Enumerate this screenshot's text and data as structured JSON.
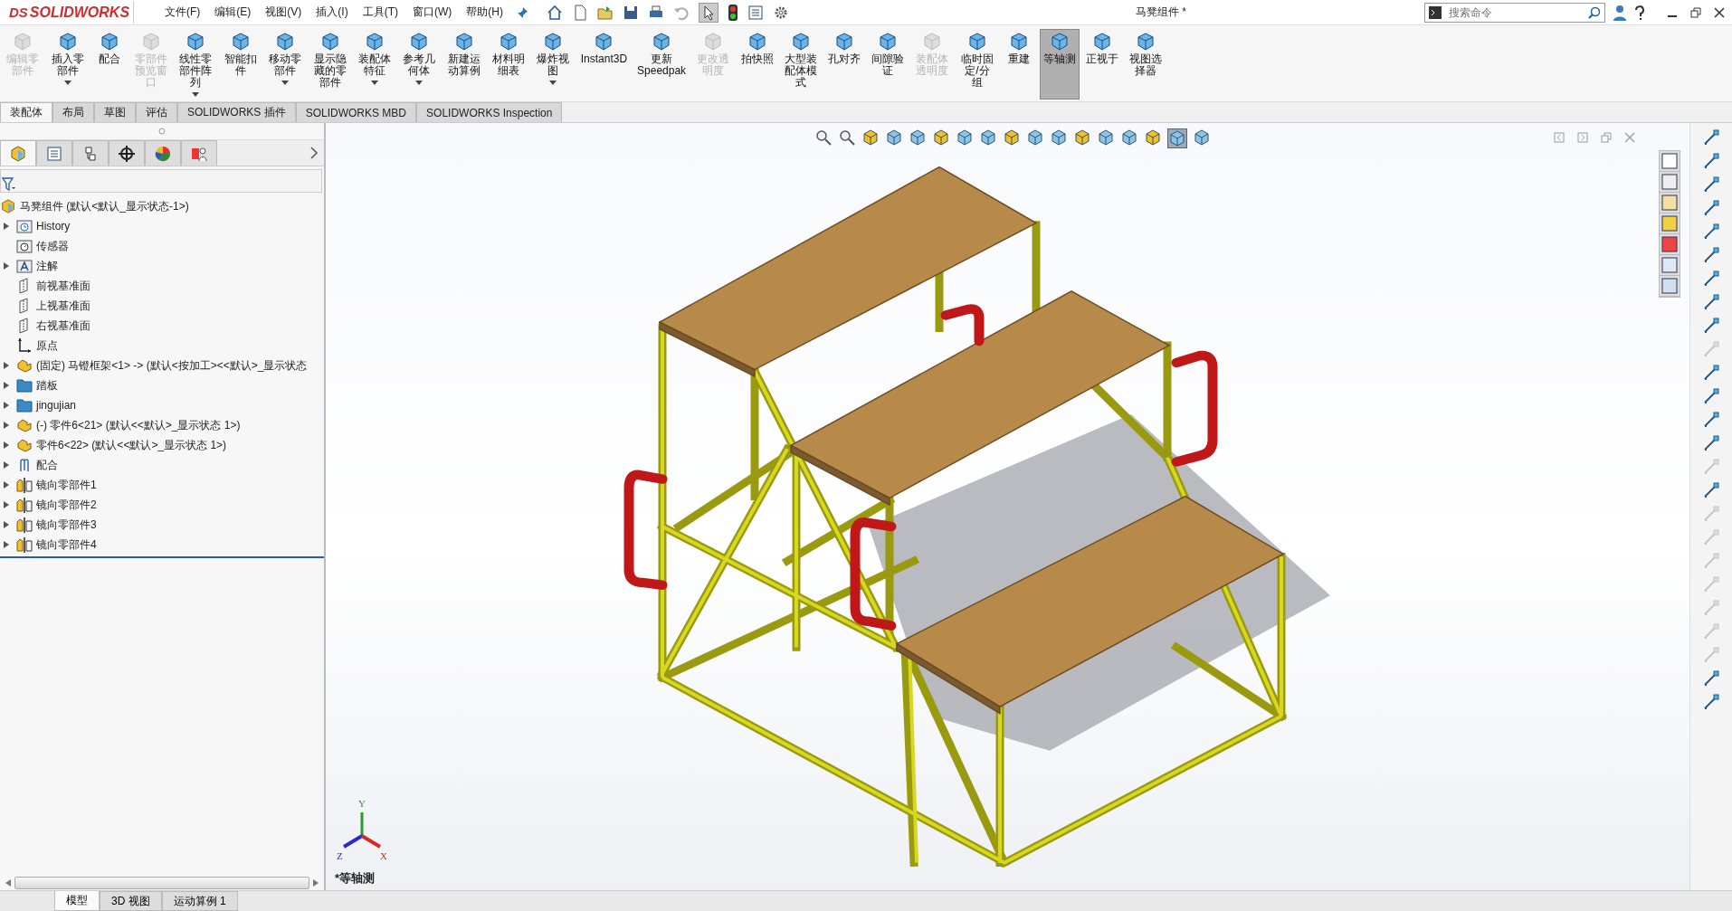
{
  "app": {
    "logo_mark": "DS",
    "logo": "SOLIDWORKS",
    "title": "马凳组件 *",
    "search": {
      "placeholder": "搜索命令"
    }
  },
  "menu": [
    "文件(F)",
    "编辑(E)",
    "视图(V)",
    "插入(I)",
    "工具(T)",
    "窗口(W)",
    "帮助(H)"
  ],
  "ribbon": [
    {
      "label": "编辑零部件",
      "disabled": true,
      "dropdown": false,
      "selected": false
    },
    {
      "label": "插入零部件",
      "disabled": false,
      "dropdown": true,
      "selected": false
    },
    {
      "label": "配合",
      "disabled": false,
      "dropdown": false,
      "selected": false
    },
    {
      "label": "零部件预览窗口",
      "disabled": true,
      "dropdown": false,
      "selected": false
    },
    {
      "label": "线性零部件阵列",
      "disabled": false,
      "dropdown": true,
      "selected": false
    },
    {
      "label": "智能扣件",
      "disabled": false,
      "dropdown": false,
      "selected": false
    },
    {
      "label": "移动零部件",
      "disabled": false,
      "dropdown": true,
      "selected": false
    },
    {
      "label": "显示隐藏的零部件",
      "disabled": false,
      "dropdown": false,
      "selected": false
    },
    {
      "label": "装配体特征",
      "disabled": false,
      "dropdown": true,
      "selected": false
    },
    {
      "label": "参考几何体",
      "disabled": false,
      "dropdown": true,
      "selected": false
    },
    {
      "label": "新建运动算例",
      "disabled": false,
      "dropdown": false,
      "selected": false
    },
    {
      "label": "材料明细表",
      "disabled": false,
      "dropdown": false,
      "selected": false
    },
    {
      "label": "爆炸视图",
      "disabled": false,
      "dropdown": true,
      "selected": false
    },
    {
      "label": "Instant3D",
      "disabled": false,
      "dropdown": false,
      "selected": false
    },
    {
      "label": "更新Speedpak",
      "disabled": false,
      "dropdown": false,
      "selected": false
    },
    {
      "label": "更改透明度",
      "disabled": true,
      "dropdown": false,
      "selected": false
    },
    {
      "label": "拍快照",
      "disabled": false,
      "dropdown": false,
      "selected": false
    },
    {
      "label": "大型装配体模式",
      "disabled": false,
      "dropdown": false,
      "selected": false
    },
    {
      "label": "孔对齐",
      "disabled": false,
      "dropdown": false,
      "selected": false
    },
    {
      "label": "间隙验证",
      "disabled": false,
      "dropdown": false,
      "selected": false
    },
    {
      "label": "装配体透明度",
      "disabled": true,
      "dropdown": false,
      "selected": false
    },
    {
      "label": "临时固定/分组",
      "disabled": false,
      "dropdown": false,
      "selected": false
    },
    {
      "label": "重建",
      "disabled": false,
      "dropdown": false,
      "selected": false
    },
    {
      "label": "等轴测",
      "disabled": false,
      "dropdown": false,
      "selected": true
    },
    {
      "label": "正视于",
      "disabled": false,
      "dropdown": false,
      "selected": false
    },
    {
      "label": "视图选择器",
      "disabled": false,
      "dropdown": false,
      "selected": false
    }
  ],
  "command_tabs": [
    {
      "label": "装配体",
      "selected": true
    },
    {
      "label": "布局",
      "selected": false
    },
    {
      "label": "草图",
      "selected": false
    },
    {
      "label": "评估",
      "selected": false
    },
    {
      "label": "SOLIDWORKS 插件",
      "selected": false
    },
    {
      "label": "SOLIDWORKS MBD",
      "selected": false
    },
    {
      "label": "SOLIDWORKS Inspection",
      "selected": false
    }
  ],
  "panel_tabs": [
    {
      "selected": true
    },
    {
      "selected": false
    },
    {
      "selected": false
    },
    {
      "selected": false
    },
    {
      "selected": false
    },
    {
      "selected": false
    }
  ],
  "tree": {
    "root": "马凳组件  (默认<默认_显示状态-1>)",
    "items": [
      {
        "kind": "history",
        "label": "History",
        "expandable": true
      },
      {
        "kind": "sensor",
        "label": "传感器",
        "expandable": false
      },
      {
        "kind": "annotation",
        "label": "注解",
        "expandable": true
      },
      {
        "kind": "plane",
        "label": "前视基准面",
        "expandable": false
      },
      {
        "kind": "plane",
        "label": "上视基准面",
        "expandable": false
      },
      {
        "kind": "plane",
        "label": "右视基准面",
        "expandable": false
      },
      {
        "kind": "origin",
        "label": "原点",
        "expandable": false
      },
      {
        "kind": "part",
        "label": "(固定) 马镫框架<1> -> (默认<按加工><<默认>_显示状态",
        "expandable": true
      },
      {
        "kind": "folder",
        "label": "踏板",
        "expandable": true
      },
      {
        "kind": "folder",
        "label": "jingujian",
        "expandable": true
      },
      {
        "kind": "part",
        "label": "(-) 零件6<21> (默认<<默认>_显示状态 1>)",
        "expandable": true
      },
      {
        "kind": "part",
        "label": "零件6<22> (默认<<默认>_显示状态 1>)",
        "expandable": true
      },
      {
        "kind": "mates",
        "label": "配合",
        "expandable": true
      },
      {
        "kind": "mirror",
        "label": "镜向零部件1",
        "expandable": true
      },
      {
        "kind": "mirror",
        "label": "镜向零部件2",
        "expandable": true
      },
      {
        "kind": "mirror",
        "label": "镜向零部件3",
        "expandable": true
      },
      {
        "kind": "mirror",
        "label": "镜向零部件4",
        "expandable": true
      }
    ]
  },
  "viewport": {
    "view_name": "*等轴测",
    "axes": [
      "Y",
      "Z",
      "X"
    ]
  },
  "sketch_tools": [
    {
      "disabled": false
    },
    {
      "disabled": false
    },
    {
      "disabled": false
    },
    {
      "disabled": false
    },
    {
      "disabled": false
    },
    {
      "disabled": false
    },
    {
      "disabled": false
    },
    {
      "disabled": false
    },
    {
      "disabled": false
    },
    {
      "disabled": true
    },
    {
      "disabled": false
    },
    {
      "disabled": false
    },
    {
      "disabled": false
    },
    {
      "disabled": false
    },
    {
      "disabled": true
    },
    {
      "disabled": false
    },
    {
      "disabled": true
    },
    {
      "disabled": true
    },
    {
      "disabled": true
    },
    {
      "disabled": true
    },
    {
      "disabled": true
    },
    {
      "disabled": true
    },
    {
      "disabled": true
    },
    {
      "disabled": false
    },
    {
      "disabled": false
    }
  ],
  "bottom_tabs": [
    {
      "label": "模型",
      "selected": true
    },
    {
      "label": "3D 视图",
      "selected": false
    },
    {
      "label": "运动算例 1",
      "selected": false
    }
  ]
}
